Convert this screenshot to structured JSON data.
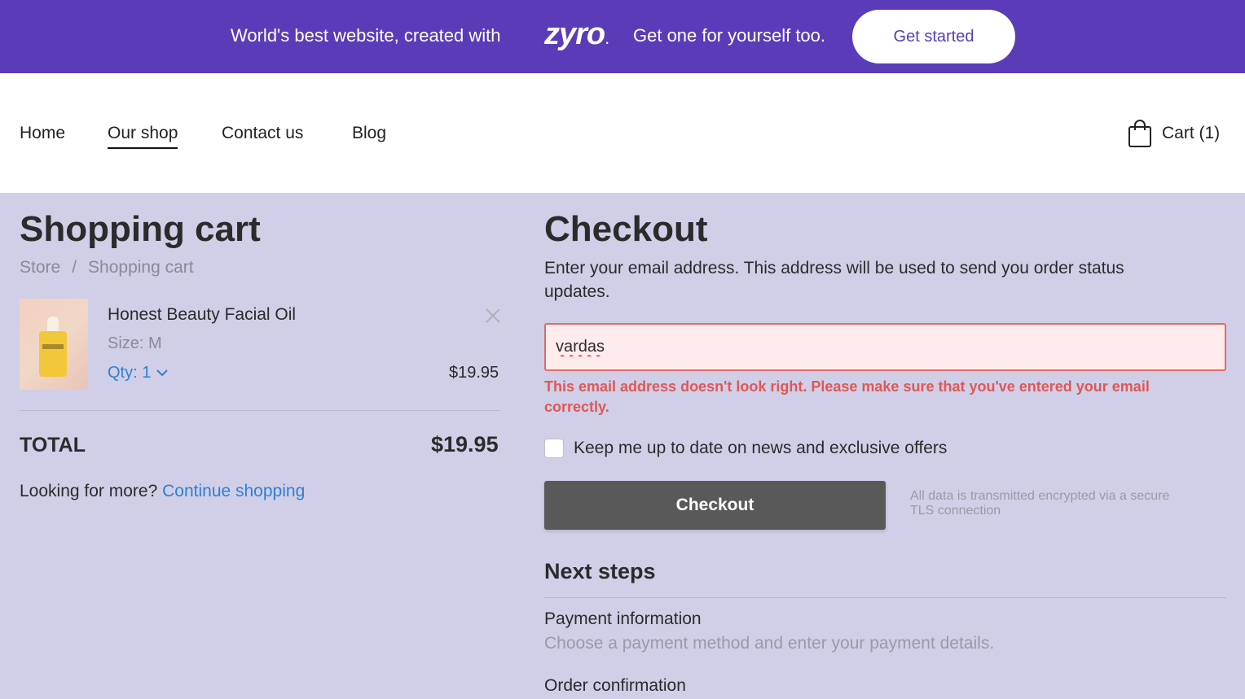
{
  "banner": {
    "left_text": "World's best website, created with",
    "logo": "zyro",
    "logo_dot": ".",
    "right_text": "Get one for yourself too.",
    "cta": "Get started",
    "bg_color": "#5a3cb8"
  },
  "nav": {
    "items": [
      {
        "label": "Home"
      },
      {
        "label": "Our shop",
        "active": true
      },
      {
        "label": "Contact us"
      },
      {
        "label": "Blog"
      }
    ],
    "cart_label": "Cart (1)",
    "cart_icon": "shopping-bag-icon"
  },
  "cart": {
    "title": "Shopping cart",
    "breadcrumb": [
      "Store",
      "Shopping cart"
    ],
    "breadcrumb_sep": "/",
    "item": {
      "name": "Honest Beauty Facial Oil",
      "size": "Size: M",
      "qty": "Qty: 1",
      "price": "$19.95",
      "remove_icon": "close-icon"
    },
    "total_label": "TOTAL",
    "total_value": "$19.95",
    "more_text": "Looking for more?",
    "more_link": "Continue shopping"
  },
  "checkout": {
    "title": "Checkout",
    "description": "Enter your email address. This address will be used to send you order status updates.",
    "email_value": "vardas",
    "error": "This email address doesn't look right. Please make sure that you've entered your email correctly.",
    "newsletter_label": "Keep me up to date on news and exclusive offers",
    "newsletter_checked": false,
    "button": "Checkout",
    "secure_note": "All data is transmitted encrypted via a secure TLS connection",
    "next_steps_title": "Next steps",
    "steps": [
      {
        "title": "Payment information",
        "desc": "Choose a payment method and enter your payment details."
      },
      {
        "title": "Order confirmation",
        "desc": ""
      }
    ]
  },
  "colors": {
    "page_bg": "#d0cfe7",
    "link": "#2f7fd3",
    "error": "#e05757",
    "button_bg": "#595959"
  }
}
